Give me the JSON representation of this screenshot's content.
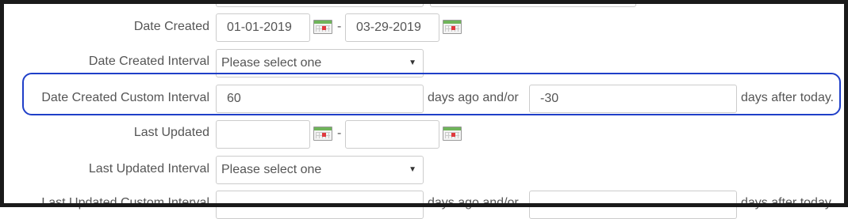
{
  "rows": {
    "date_created": {
      "label": "Date Created",
      "from": "01-01-2019",
      "to": "03-29-2019",
      "separator": "-"
    },
    "date_created_interval": {
      "label": "Date Created Interval",
      "selected": "Please select one"
    },
    "date_created_custom": {
      "label": "Date Created Custom Interval",
      "days_ago": "60",
      "days_ago_suffix": "days ago and/or",
      "days_after": "-30",
      "days_after_suffix": "days after today."
    },
    "last_updated": {
      "label": "Last Updated",
      "from": "",
      "to": "",
      "separator": "-"
    },
    "last_updated_interval": {
      "label": "Last Updated Interval",
      "selected": "Please select one"
    },
    "last_updated_custom": {
      "label": "Last Updated Custom Interval",
      "days_ago_suffix": "days ago and/or",
      "days_after_suffix": "days after today."
    }
  },
  "icons": {
    "calendar": "calendar-icon",
    "dropdown": "chevron-down-icon"
  },
  "colors": {
    "highlight": "#1f3fc8",
    "calendar_bar": "#6fb45a",
    "calendar_mark": "#e0393e"
  }
}
